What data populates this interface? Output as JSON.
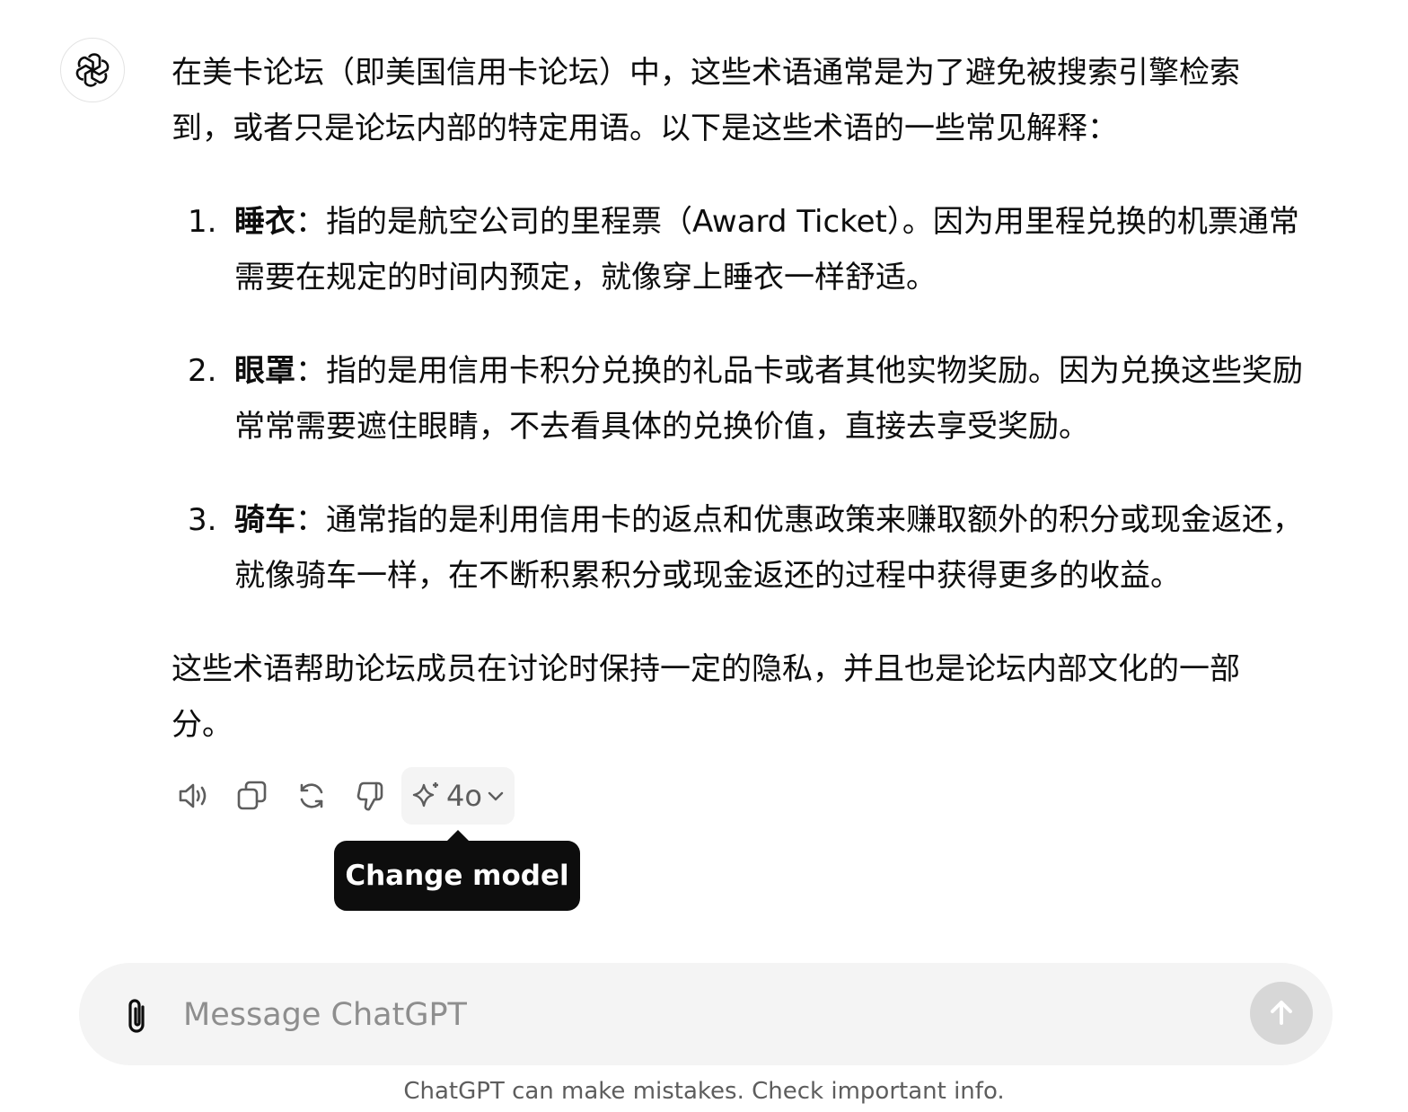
{
  "assistant": {
    "avatar_icon": "openai-logo-icon"
  },
  "message": {
    "intro": "在美卡论坛（即美国信用卡论坛）中，这些术语通常是为了避免被搜索引擎检索到，或者只是论坛内部的特定用语。以下是这些术语的一些常见解释：",
    "items": [
      {
        "num": "1.",
        "term": "睡衣",
        "text": "：指的是航空公司的里程票（Award Ticket）。因为用里程兑换的机票通常需要在规定的时间内预定，就像穿上睡衣一样舒适。"
      },
      {
        "num": "2.",
        "term": "眼罩",
        "text": "：指的是用信用卡积分兑换的礼品卡或者其他实物奖励。因为兑换这些奖励常常需要遮住眼睛，不去看具体的兑换价值，直接去享受奖励。"
      },
      {
        "num": "3.",
        "term": "骑车",
        "text": "：通常指的是利用信用卡的返点和优惠政策来赚取额外的积分或现金返还，就像骑车一样，在不断积累积分或现金返还的过程中获得更多的收益。"
      }
    ],
    "outro": "这些术语帮助论坛成员在讨论时保持一定的隐私，并且也是论坛内部文化的一部分。"
  },
  "actions": {
    "icons": [
      "speaker-icon",
      "copy-icon",
      "regenerate-icon",
      "thumbs-down-icon",
      "sparkle-icon",
      "chevron-down-icon"
    ],
    "model_label": "4o",
    "tooltip": "Change model"
  },
  "composer": {
    "placeholder": "Message ChatGPT",
    "value": ""
  },
  "footer": {
    "disclaimer": "ChatGPT can make mistakes. Check important info."
  },
  "colors": {
    "text": "#0d0d0d",
    "muted": "#5d5d5d",
    "composer_bg": "#f4f4f4",
    "send_disabled": "#d7d7d7",
    "tooltip_bg": "#0d0d0d"
  }
}
